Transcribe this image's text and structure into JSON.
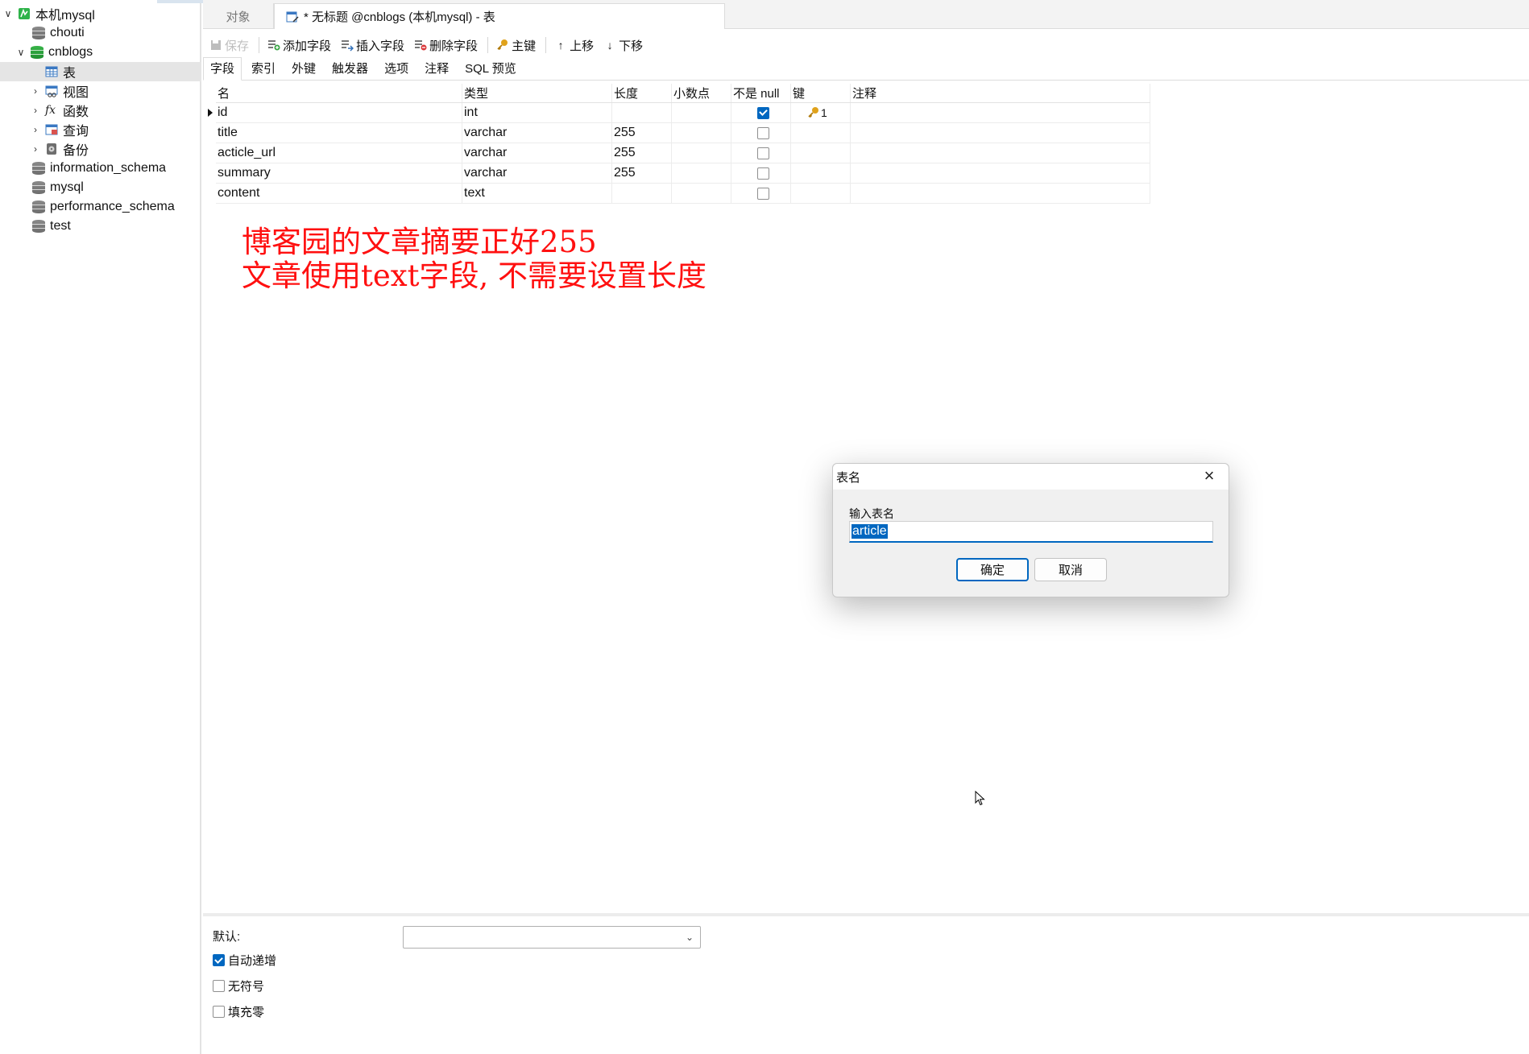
{
  "sidebar": {
    "connection": "本机mysql",
    "items": [
      {
        "label": "chouti"
      },
      {
        "label": "cnblogs"
      },
      {
        "label": "表"
      },
      {
        "label": "视图"
      },
      {
        "label": "函数"
      },
      {
        "label": "查询"
      },
      {
        "label": "备份"
      },
      {
        "label": "information_schema"
      },
      {
        "label": "mysql"
      },
      {
        "label": "performance_schema"
      },
      {
        "label": "test"
      }
    ]
  },
  "tabs": {
    "objects": "对象",
    "active": "* 无标题 @cnblogs (本机mysql) - 表"
  },
  "toolbar": {
    "save": "保存",
    "add_field": "添加字段",
    "insert_field": "插入字段",
    "delete_field": "删除字段",
    "primary_key": "主键",
    "move_up": "上移",
    "move_down": "下移"
  },
  "subtabs": [
    "字段",
    "索引",
    "外键",
    "触发器",
    "选项",
    "注释",
    "SQL 预览"
  ],
  "grid": {
    "headers": [
      "名",
      "类型",
      "长度",
      "小数点",
      "不是 null",
      "键",
      "注释"
    ],
    "rows": [
      {
        "name": "id",
        "type": "int",
        "length": "",
        "decimals": "",
        "not_null": true,
        "key": "1",
        "comment": ""
      },
      {
        "name": "title",
        "type": "varchar",
        "length": "255",
        "decimals": "",
        "not_null": false,
        "key": "",
        "comment": ""
      },
      {
        "name": "acticle_url",
        "type": "varchar",
        "length": "255",
        "decimals": "",
        "not_null": false,
        "key": "",
        "comment": ""
      },
      {
        "name": "summary",
        "type": "varchar",
        "length": "255",
        "decimals": "",
        "not_null": false,
        "key": "",
        "comment": ""
      },
      {
        "name": "content",
        "type": "text",
        "length": "",
        "decimals": "",
        "not_null": false,
        "key": "",
        "comment": ""
      }
    ]
  },
  "annotation": {
    "line1": "博客园的文章摘要正好255",
    "line2": "文章使用text字段, 不需要设置长度",
    "color": "#ff1010"
  },
  "bottom": {
    "default_label": "默认:",
    "default_value": "",
    "auto_increment": "自动递增",
    "auto_increment_checked": true,
    "unsigned": "无符号",
    "unsigned_checked": false,
    "zerofill": "填充零",
    "zerofill_checked": false
  },
  "dialog": {
    "title": "表名",
    "prompt": "输入表名",
    "value": "article",
    "ok": "确定",
    "cancel": "取消"
  },
  "colors": {
    "accent": "#0067c0",
    "db_active": "#1e8e2f",
    "annotation": "#ff1010"
  }
}
